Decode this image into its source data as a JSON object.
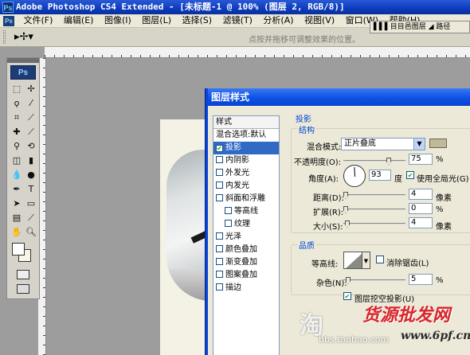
{
  "titlebar": {
    "text": "Adobe Photoshop CS4 Extended - [未标题-1 @ 100% (图层 2, RGB/8)]",
    "app_icon": "Ps"
  },
  "menubar": {
    "logo": "Ps",
    "items": [
      "文件(F)",
      "编辑(E)",
      "图像(I)",
      "图层(L)",
      "选择(S)",
      "滤镜(T)",
      "分析(A)",
      "视图(V)",
      "窗口(W)",
      "帮助(H)"
    ]
  },
  "optionsbar": {
    "hint": "点按并拖移可调整效果的位置。"
  },
  "panel_dock": {
    "text": "▌▌▌目目邑图层 ◢ 路径"
  },
  "toolbox": {
    "logo": "Ps"
  },
  "dialog": {
    "title": "图层样式",
    "style_list": {
      "header": "样式",
      "items": [
        {
          "label": "混合选项:默认",
          "checkbox": false,
          "checked": false,
          "selected": false,
          "sub": false
        },
        {
          "label": "投影",
          "checkbox": true,
          "checked": true,
          "selected": true,
          "sub": false
        },
        {
          "label": "内阴影",
          "checkbox": true,
          "checked": false,
          "selected": false,
          "sub": false
        },
        {
          "label": "外发光",
          "checkbox": true,
          "checked": false,
          "selected": false,
          "sub": false
        },
        {
          "label": "内发光",
          "checkbox": true,
          "checked": false,
          "selected": false,
          "sub": false
        },
        {
          "label": "斜面和浮雕",
          "checkbox": true,
          "checked": false,
          "selected": false,
          "sub": false
        },
        {
          "label": "等高线",
          "checkbox": true,
          "checked": false,
          "selected": false,
          "sub": true
        },
        {
          "label": "纹理",
          "checkbox": true,
          "checked": false,
          "selected": false,
          "sub": true
        },
        {
          "label": "光泽",
          "checkbox": true,
          "checked": false,
          "selected": false,
          "sub": false
        },
        {
          "label": "颜色叠加",
          "checkbox": true,
          "checked": false,
          "selected": false,
          "sub": false
        },
        {
          "label": "渐变叠加",
          "checkbox": true,
          "checked": false,
          "selected": false,
          "sub": false
        },
        {
          "label": "图案叠加",
          "checkbox": true,
          "checked": false,
          "selected": false,
          "sub": false
        },
        {
          "label": "描边",
          "checkbox": true,
          "checked": false,
          "selected": false,
          "sub": false
        }
      ]
    },
    "drop_shadow": {
      "section": "投影",
      "structure": {
        "title": "结构",
        "blend_mode_label": "混合模式:",
        "blend_mode_value": "正片叠底",
        "shadow_color": "#c1b895",
        "opacity_label": "不透明度(O):",
        "opacity_value": "75",
        "opacity_unit": "%",
        "angle_label": "角度(A):",
        "angle_value": "93",
        "angle_unit": "度",
        "global_light_label": "使用全局光(G)",
        "global_light_checked": true,
        "distance_label": "距离(D):",
        "distance_value": "4",
        "distance_unit": "像素",
        "spread_label": "扩展(R):",
        "spread_value": "0",
        "spread_unit": "%",
        "size_label": "大小(S):",
        "size_value": "4",
        "size_unit": "像素"
      },
      "quality": {
        "title": "品质",
        "contour_label": "等高线:",
        "anti_alias_label": "消除锯齿(L)",
        "anti_alias_checked": false,
        "noise_label": "杂色(N):",
        "noise_value": "5",
        "noise_unit": "%"
      },
      "knockout_label": "图层挖空投影(U)",
      "knockout_checked": true
    }
  },
  "watermarks": {
    "tao": "淘",
    "site_cn": "货源批发网",
    "url1": "bbs.taobao.com",
    "url2": "www.6pf.cn"
  }
}
